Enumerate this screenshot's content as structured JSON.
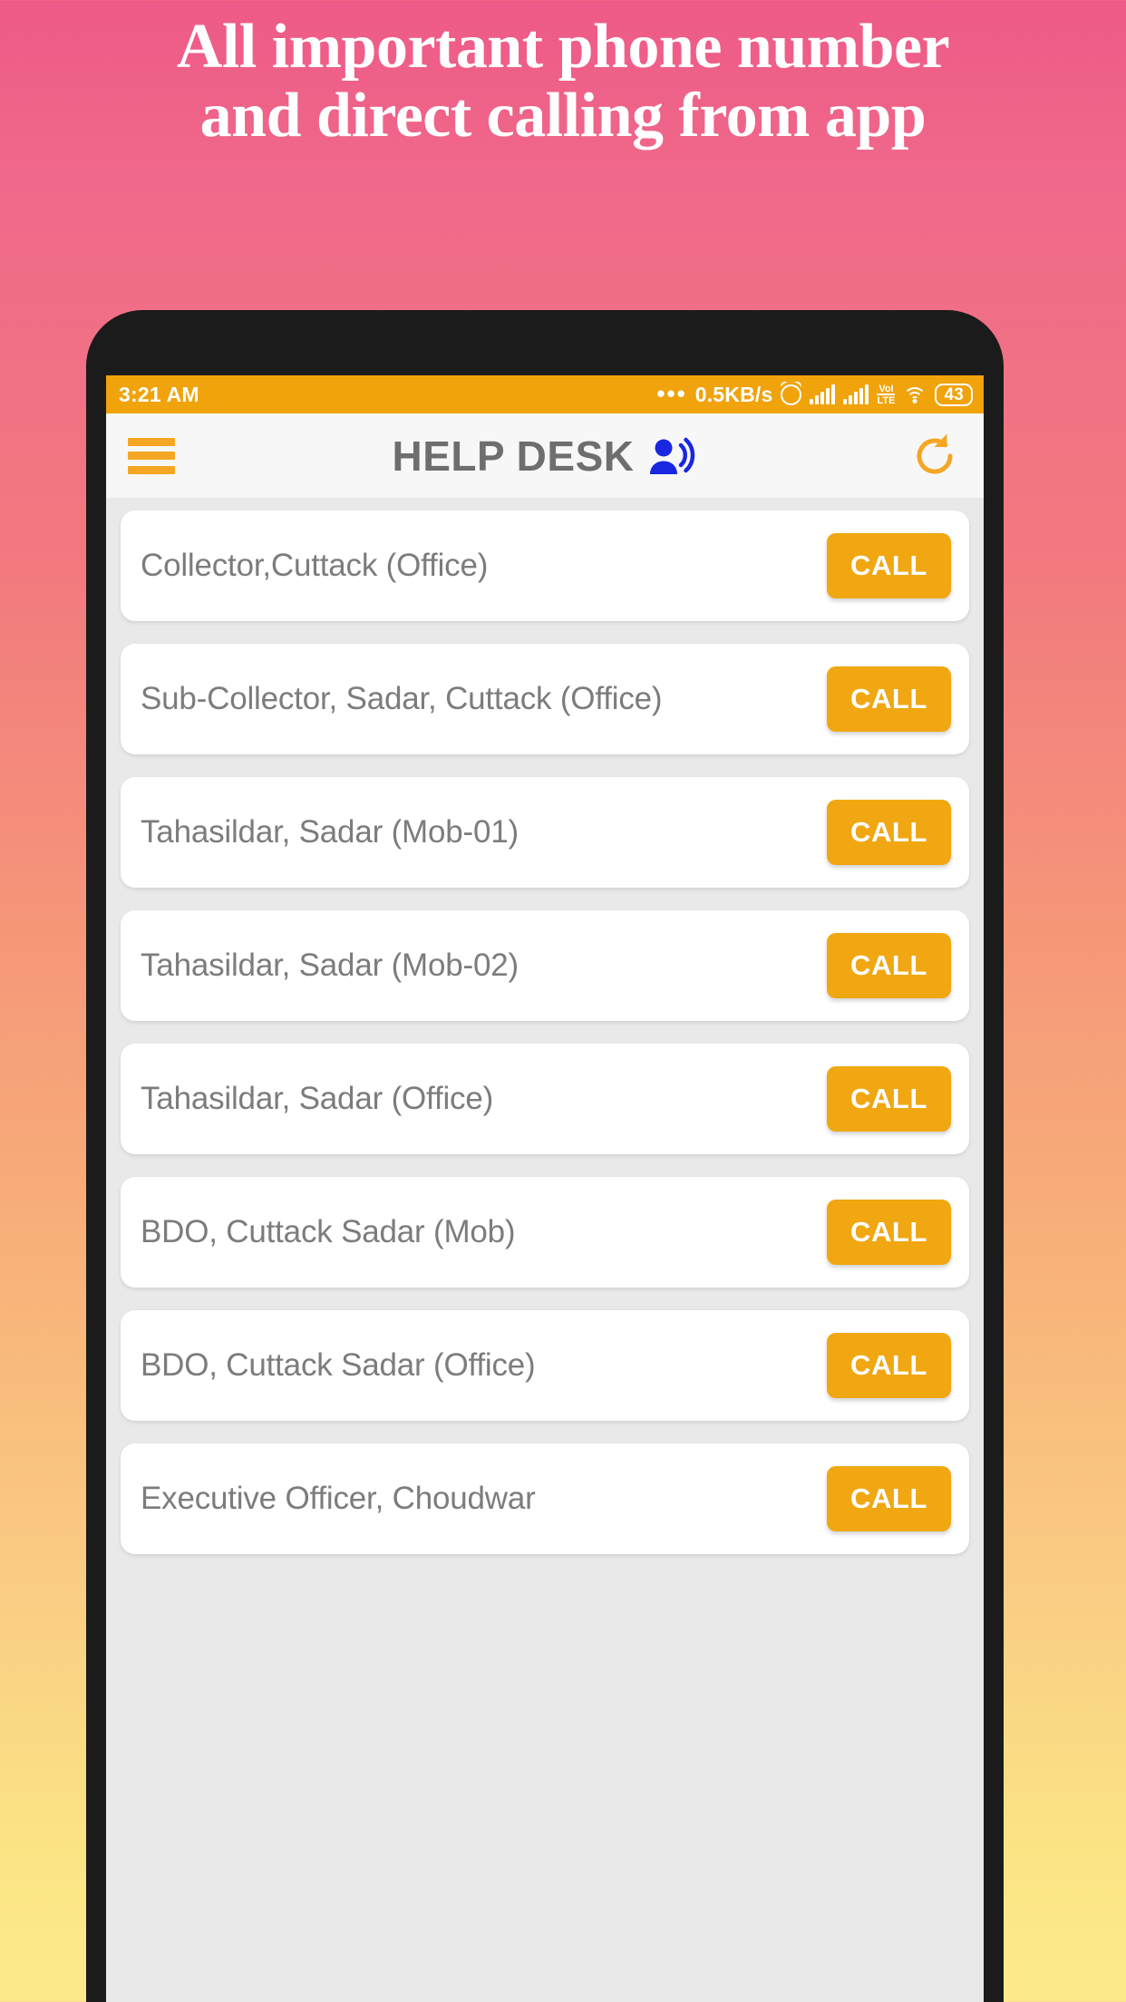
{
  "promo": {
    "line1": "All important phone number",
    "line2": "and direct calling from app"
  },
  "statusbar": {
    "time": "3:21 AM",
    "dots": "•••",
    "network_speed": "0.5KB/s",
    "alarm_icon": "alarm-icon",
    "signal_icon_1": "signal-bars-icon",
    "signal_icon_2": "signal-bars-icon",
    "volte_top": "VoI",
    "volte_bottom": "LTE",
    "wifi_icon": "wifi-icon",
    "battery_level": "43"
  },
  "appbar": {
    "menu_icon": "hamburger-menu-icon",
    "title": "HELP DESK",
    "title_icon": "person-speaking-icon",
    "refresh_icon": "refresh-icon"
  },
  "colors": {
    "accent_orange": "#F0A711",
    "status_orange": "#F0A30A",
    "title_gray": "#6E6E6E",
    "row_text_gray": "#7C7C7C",
    "list_bg": "#E9E9E9",
    "appbar_bg": "#F7F7F7",
    "icon_blue": "#1A27E0",
    "phone_frame": "#1C1B1B"
  },
  "list": {
    "call_label": "CALL",
    "rows": [
      {
        "label": "Collector,Cuttack (Office)"
      },
      {
        "label": "Sub-Collector, Sadar, Cuttack (Office)"
      },
      {
        "label": "Tahasildar, Sadar (Mob-01)"
      },
      {
        "label": "Tahasildar, Sadar (Mob-02)"
      },
      {
        "label": "Tahasildar, Sadar (Office)"
      },
      {
        "label": "BDO, Cuttack Sadar (Mob)"
      },
      {
        "label": "BDO, Cuttack Sadar (Office)"
      },
      {
        "label": "Executive Officer, Choudwar"
      }
    ]
  }
}
